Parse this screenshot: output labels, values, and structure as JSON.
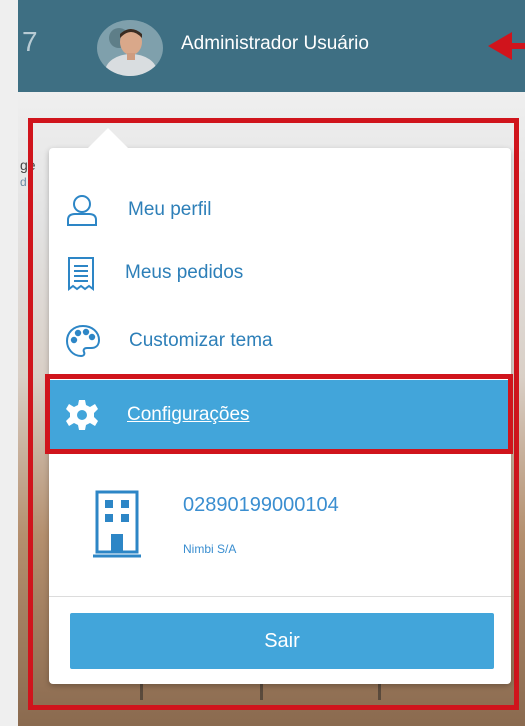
{
  "header": {
    "partial_text": "7",
    "user_name": "Administrador Usuário"
  },
  "background": {
    "partial_text_1": "ge",
    "partial_text_2": "d"
  },
  "menu": {
    "items": [
      {
        "label": "Meu perfil",
        "icon": "user-icon"
      },
      {
        "label": "Meus pedidos",
        "icon": "receipt-icon"
      },
      {
        "label": "Customizar tema",
        "icon": "palette-icon"
      },
      {
        "label": "Configurações",
        "icon": "gear-icon",
        "active": true
      }
    ]
  },
  "company": {
    "id": "02890199000104",
    "name": "Nimbi S/A",
    "icon": "building-icon"
  },
  "logout_label": "Sair",
  "colors": {
    "topbar": "#3e6f83",
    "accent": "#42a5da",
    "link": "#2d7fb8",
    "highlight_outline": "#d0141c"
  }
}
